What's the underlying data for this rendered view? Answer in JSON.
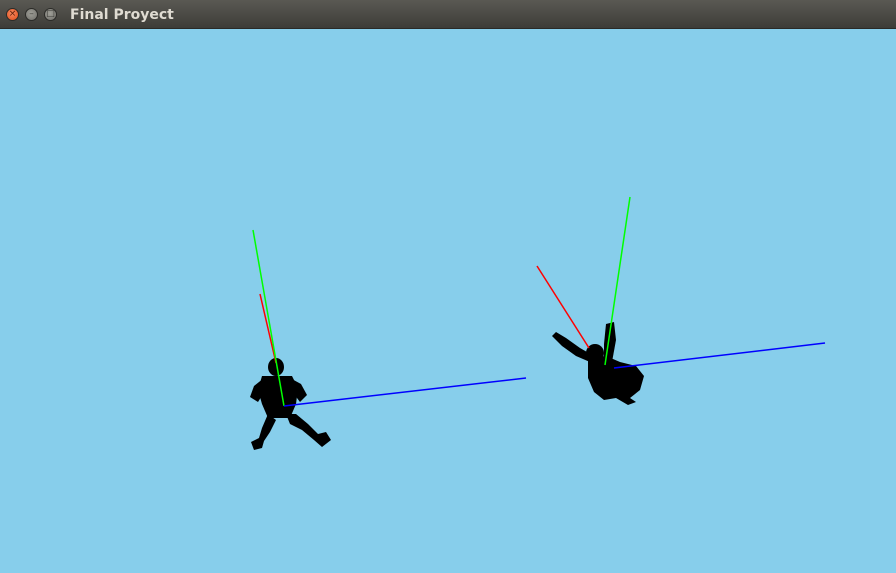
{
  "window": {
    "title": "Final Proyect",
    "controls": {
      "close_glyph": "×",
      "minimize_glyph": "–",
      "maximize_glyph": "□"
    }
  },
  "scene": {
    "background_color": "#87ceeb",
    "axis_colors": {
      "x": "#ff0000",
      "y": "#00ff00",
      "z": "#0000ff"
    },
    "figure_color": "#000000",
    "objects": [
      {
        "name": "figure-left",
        "pose": "standing, legs apart"
      },
      {
        "name": "figure-right",
        "pose": "crouching, arm raised"
      }
    ]
  }
}
